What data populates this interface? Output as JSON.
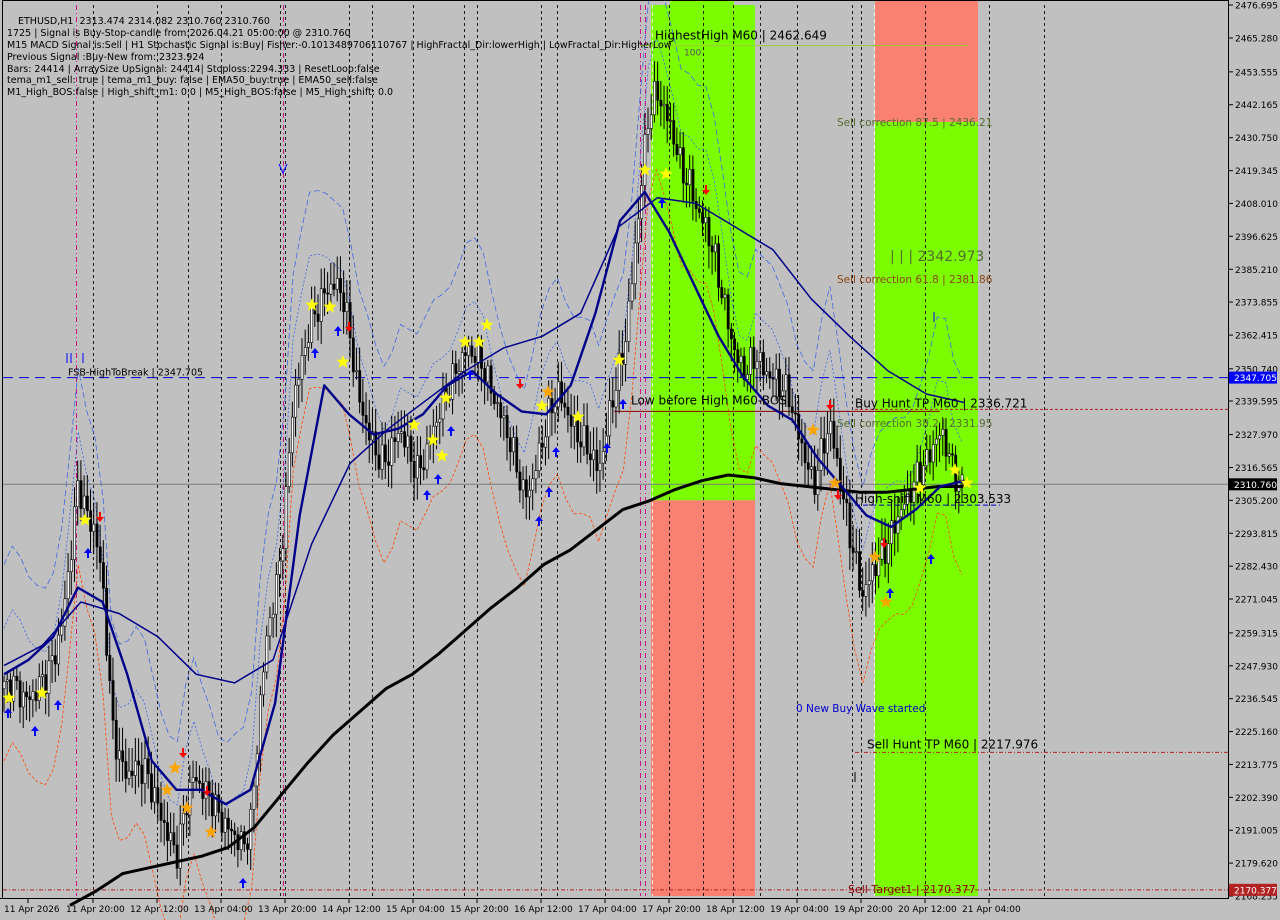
{
  "symbol_line": "ETHUSD,H1  2313.474 2314.082 2310.760 2310.760",
  "info_lines": [
    "1725 | Signal is Buy-Stop-candle from:2026.04.21 05:00:00 @ 2310.760",
    "M15 MACD Signal is:Sell | H1 Stochastic Signal is:Buy| Fisher:-0.1013489706110767 | HighFractal_Dir:lowerHigh | LowFractal_Dir:HigherLow",
    "Previous Signal :Buy-New from: 2323.924",
    "Bars: 24414 | ArraySize UpSignal: 24414| Stoploss:2294.333 | ResetLoop:false",
    "tema_m1_sell: true | tema_m1_buy: false | EMA50_buy:true | EMA50_sell:false",
    "M1_High_BOS:false | High_shift_m1: 0.0 | M5_High_BOS:false | M5_High_shift: 0.0"
  ],
  "colors": {
    "background": "#c0c0c0",
    "grid": "#000000",
    "green_zone": "#7cfc00",
    "red_zone": "#fa8072",
    "ema_black": "#000000",
    "ema_navy": "#00008b",
    "buy_arrow": "#0000ff",
    "sell_arrow": "#ff0000",
    "star": "#ffff00",
    "star_orange": "#ffa500",
    "current_price_bg": "#000000",
    "blue_price_bg": "#0000ff",
    "red_price_bg": "#b22222"
  },
  "chart_data": {
    "type": "candlestick",
    "symbol": "ETHUSD",
    "timeframe": "H1",
    "ohlc_header": {
      "open": 2313.474,
      "high": 2314.082,
      "low": 2310.76,
      "close": 2310.76
    },
    "y_ticks": [
      2476.695,
      2465.28,
      2453.555,
      2442.165,
      2430.75,
      2419.345,
      2408.01,
      2396.625,
      2385.21,
      2373.855,
      2362.415,
      2350.74,
      2339.595,
      2327.97,
      2316.565,
      2305.2,
      2293.815,
      2282.43,
      2271.045,
      2259.315,
      2247.93,
      2236.545,
      2225.16,
      2213.775,
      2202.39,
      2191.005,
      2179.62,
      2168.235
    ],
    "ylim": [
      2168.235,
      2476.695
    ],
    "x_ticks": [
      "11 Apr 2026",
      "11 Apr 20:00",
      "12 Apr 12:00",
      "13 Apr 04:00",
      "13 Apr 20:00",
      "14 Apr 12:00",
      "15 Apr 04:00",
      "15 Apr 20:00",
      "16 Apr 12:00",
      "17 Apr 04:00",
      "17 Apr 20:00",
      "18 Apr 12:00",
      "19 Apr 04:00",
      "19 Apr 20:00",
      "20 Apr 12:00",
      "21 Apr 04:00"
    ],
    "price_tags": [
      {
        "value": 2347.705,
        "label": "2347.705",
        "kind": "blue"
      },
      {
        "value": 2310.76,
        "label": "2310.760",
        "kind": "current"
      },
      {
        "value": 2170.377,
        "label": "2170.377",
        "kind": "red"
      }
    ],
    "close_path": [
      2240,
      2242,
      2238,
      2236,
      2240,
      2244,
      2250,
      2262,
      2285,
      2312,
      2300,
      2295,
      2275,
      2230,
      2215,
      2210,
      2213,
      2212,
      2205,
      2196,
      2188,
      2183,
      2200,
      2210,
      2205,
      2203,
      2196,
      2192,
      2189,
      2185,
      2195,
      2235,
      2262,
      2275,
      2300,
      2340,
      2352,
      2366,
      2372,
      2378,
      2380,
      2377,
      2360,
      2340,
      2330,
      2322,
      2318,
      2324,
      2330,
      2322,
      2315,
      2320,
      2330,
      2338,
      2345,
      2352,
      2357,
      2356,
      2352,
      2343,
      2336,
      2328,
      2318,
      2306,
      2312,
      2324,
      2335,
      2343,
      2337,
      2330,
      2326,
      2322,
      2315,
      2330,
      2345,
      2356,
      2380,
      2410,
      2438,
      2447,
      2440,
      2432,
      2420,
      2415,
      2405,
      2400,
      2390,
      2376,
      2362,
      2352,
      2350,
      2356,
      2350,
      2348,
      2345,
      2342,
      2330,
      2320,
      2310,
      2322,
      2332,
      2316,
      2300,
      2285,
      2272,
      2280,
      2285,
      2290,
      2298,
      2304,
      2310,
      2316,
      2320,
      2328,
      2326,
      2314,
      2311
    ],
    "ema_black": [
      2165,
      2170,
      2176,
      2178,
      2180,
      2182,
      2185,
      2192,
      2203,
      2214,
      2224,
      2232,
      2240,
      2245,
      2252,
      2260,
      2268,
      2275,
      2283,
      2288,
      2295,
      2302,
      2305,
      2309,
      2312,
      2314,
      2313,
      2311,
      2310,
      2309,
      2308,
      2308,
      2309,
      2310,
      2310
    ],
    "ema_navy_fast": [
      2245,
      2250,
      2258,
      2275,
      2270,
      2245,
      2215,
      2205,
      2205,
      2200,
      2205,
      2235,
      2300,
      2345,
      2335,
      2328,
      2330,
      2335,
      2345,
      2350,
      2342,
      2336,
      2335,
      2345,
      2370,
      2402,
      2412,
      2398,
      2380,
      2362,
      2348,
      2338,
      2333,
      2320,
      2310,
      2300,
      2296,
      2302,
      2310,
      2312
    ],
    "ema_navy_slow": [
      2248,
      2255,
      2270,
      2266,
      2258,
      2245,
      2242,
      2250,
      2290,
      2318,
      2330,
      2340,
      2350,
      2358,
      2362,
      2370,
      2400,
      2410,
      2408,
      2400,
      2392,
      2375,
      2362,
      2350,
      2342,
      2339
    ],
    "annotations": [
      {
        "text": "HighestHigh   M60 | 2462.649",
        "value": 2462.649
      },
      {
        "text": "100",
        "value": 2461.0
      },
      {
        "text": "Sell correction 87.5 | 2436.21",
        "value": 2436.21
      },
      {
        "text": "| | | 2342.973",
        "value": 2387.0
      },
      {
        "text": "Sell correction 61.8 | 2381.86",
        "value": 2381.86
      },
      {
        "text": "FSB-HighToBreak | 2347.705",
        "value": 2347.705
      },
      {
        "text": "Low before High   M60-BOS",
        "value": 2337.0
      },
      {
        "text": "Buy Hunt TP M60 | 2336.721",
        "value": 2336.721
      },
      {
        "text": "Sell correction 38.2 | 2331.95",
        "value": 2331.95
      },
      {
        "text": "High-shift M60 | 2303.533",
        "value": 2303.533
      },
      {
        "text": "0 New Buy Wave started",
        "value": 2232.0
      },
      {
        "text": "Sell Hunt TP M60 | 2217.976",
        "value": 2217.976
      },
      {
        "text": "Sell Target1 | 2170.377",
        "value": 2170.377
      }
    ]
  }
}
